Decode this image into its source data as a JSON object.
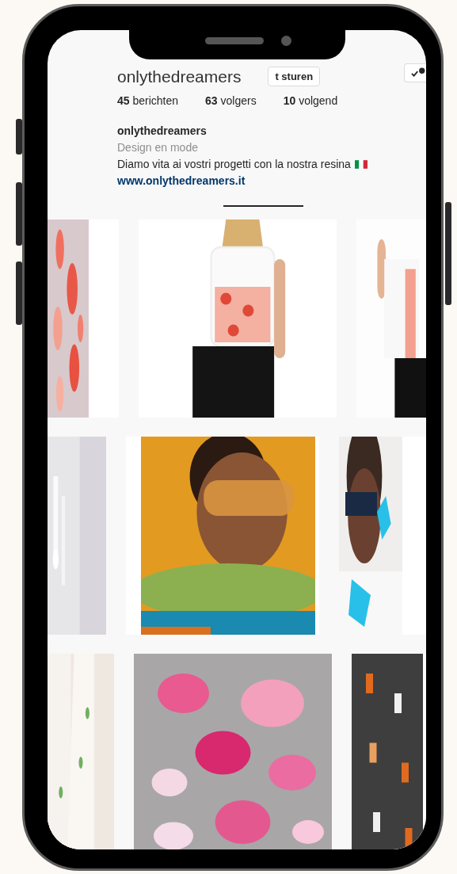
{
  "header": {
    "username": "onlythedreamers",
    "message_button": "t sturen"
  },
  "stats": [
    "**45** berichten",
    "**63** volgers",
    "**10** volgend"
  ],
  "bio": {
    "name": "onlythedreamers",
    "category": "Design en mode",
    "text": "Diamo vita ai vostri progetti con la nostra resina",
    "link": "www.onlythedreamers.it"
  }
}
